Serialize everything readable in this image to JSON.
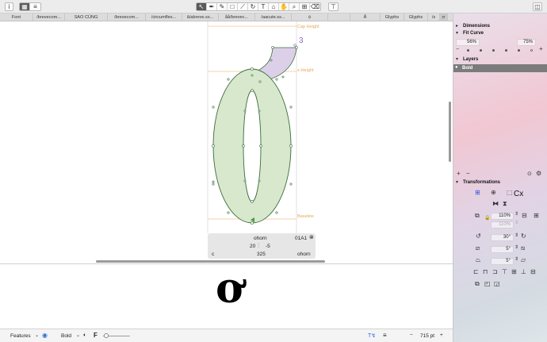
{
  "toolbar": {
    "info_icon": "i",
    "view_grid_icon": "grid-icon",
    "view_list_icon": "list-icon",
    "tools": [
      "select-arrow-icon",
      "draw-pen-icon",
      "draw-pencil-icon",
      "primitives-icon",
      "rotate-icon",
      "scale-icon",
      "text-icon",
      "annotation-icon",
      "hand-icon",
      "zoom-icon",
      "measure-icon",
      "eraser-icon",
      "text-tool-icon"
    ],
    "sidebar_toggle_icon": "sidebar-icon"
  },
  "tabs": [
    "Font",
    "/brevecom...",
    "SAO CÙNG",
    "/brevecom...",
    "/circumflex...",
    "ă/abreve.ss...",
    "ẵẵ/brevec...",
    "/aacute.ss...",
    "ọ́",
    "",
    "Ẫ",
    "Glyphs",
    "Glyphs",
    "/s",
    "ơ"
  ],
  "canvas": {
    "metrics": {
      "cap_height": "Cap Height",
      "x_height": "x-Height",
      "baseline": "Baseline"
    },
    "anchor_label": "3",
    "glyph_fill": "#d7e8cd",
    "glyph_stroke": "#3c6b3c",
    "horn_fill": "#dcd0e8",
    "metric_color": "#e8a85a"
  },
  "info_box": {
    "glyph_name": "ohorn",
    "unicode": "01A1",
    "lsb": "20",
    "rsb": "-5",
    "width": "325",
    "left_group": "c",
    "right_group": "ohorn"
  },
  "preview": {
    "glyph": "ơ"
  },
  "bottom_bar": {
    "features_label": "Features",
    "master_label": "Bold",
    "size_label": "715 pt",
    "minus": "−",
    "plus": "+"
  },
  "panel": {
    "dimensions_label": "Dimensions",
    "fit_curve_label": "Fit Curve",
    "fit_curve_min": "56%",
    "fit_curve_max": "75%",
    "layers_label": "Layers",
    "layer_name": "Bold",
    "transformations_label": "Transformations",
    "scale_value": "110%",
    "scale_value_2": "110%",
    "rotate_value": "30°",
    "slant_value": "5°",
    "slant_value_2": "5°",
    "transform_label_cx": "Cx"
  }
}
